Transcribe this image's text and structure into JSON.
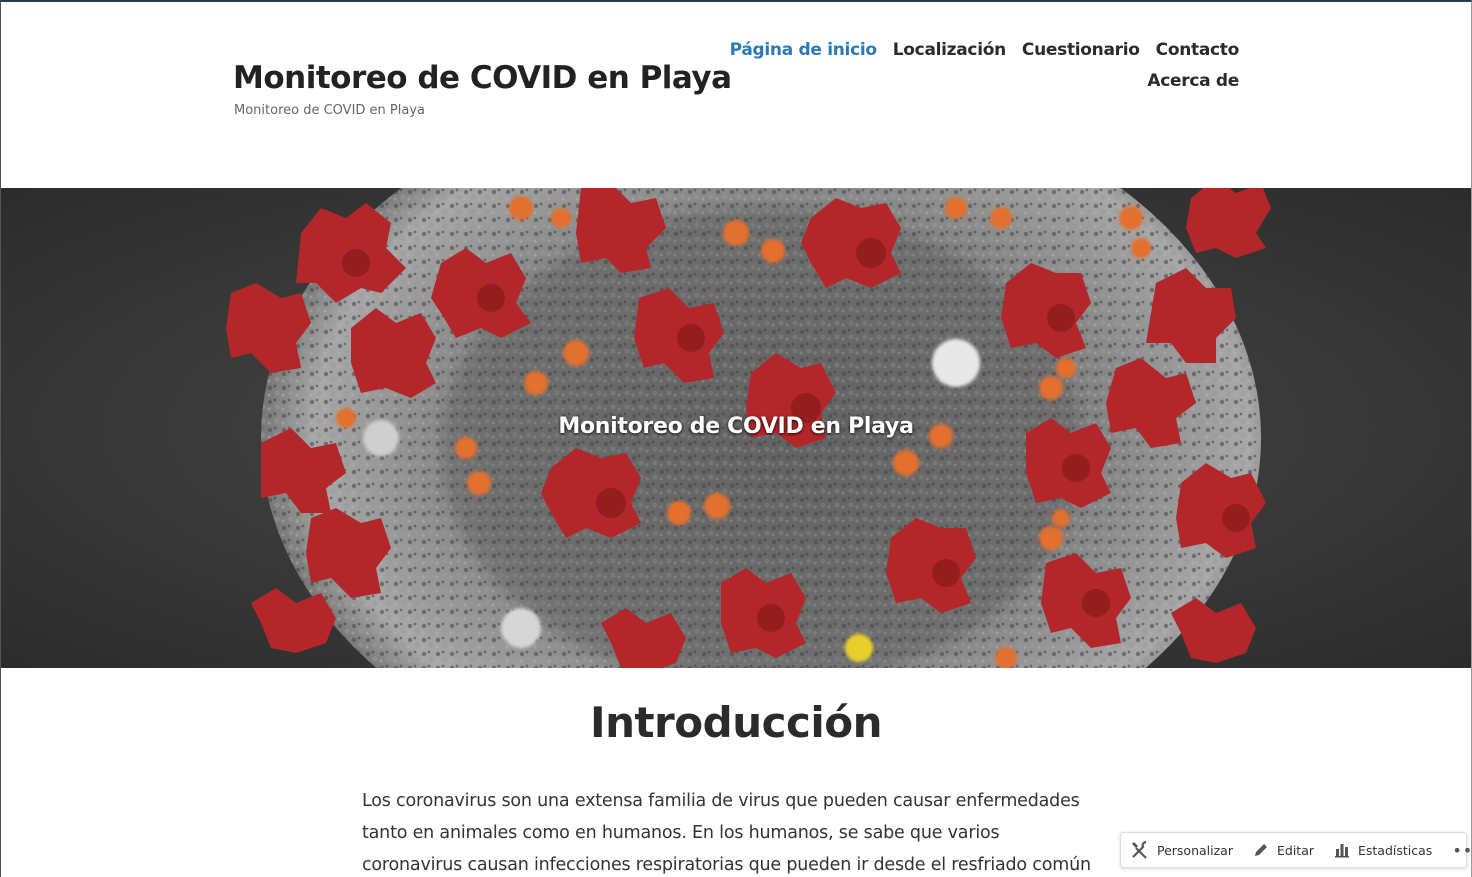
{
  "site": {
    "title": "Monitoreo de COVID en Playa",
    "tagline": "Monitoreo de COVID en Playa"
  },
  "nav": {
    "items": [
      {
        "label": "Página de inicio",
        "active": true
      },
      {
        "label": "Localización",
        "active": false
      },
      {
        "label": "Cuestionario",
        "active": false
      },
      {
        "label": "Contacto",
        "active": false
      },
      {
        "label": "Acerca de",
        "active": false
      }
    ]
  },
  "hero": {
    "title": "Monitoreo de COVID en Playa",
    "image_icon": "coronavirus-illustration"
  },
  "content": {
    "heading": "Introducción",
    "paragraph": "Los coronavirus son una extensa familia de virus que pueden causar enfermedades tanto en animales como en humanos. En los humanos, se sabe que varios coronavirus causan infecciones respiratorias que pueden ir desde el resfriado común hasta"
  },
  "action_bar": {
    "customize_label": "Personalizar",
    "customize_icon": "tools-icon",
    "edit_label": "Editar",
    "edit_icon": "pencil-icon",
    "stats_label": "Estadísticas",
    "stats_icon": "bar-chart-icon",
    "more_label": "•••"
  },
  "colors": {
    "accent": "#2a7ab8",
    "text": "#2b2b2b",
    "virus_red": "#b3272a",
    "virus_orange": "#e0712f",
    "virus_gray": "#8a8a8a"
  }
}
